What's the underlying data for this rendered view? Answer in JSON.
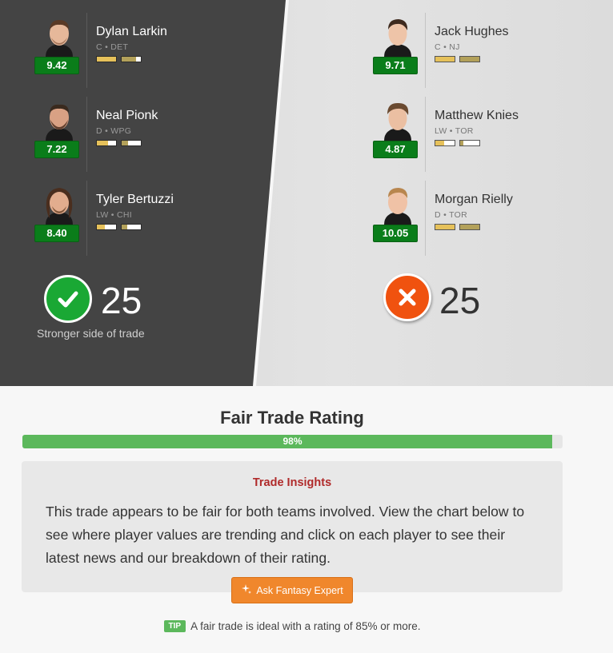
{
  "left_side": {
    "players": [
      {
        "name": "Dylan Larkin",
        "position": "C • DET",
        "rating": "9.42",
        "bar1": 1.0,
        "bar2": 0.75
      },
      {
        "name": "Neal Pionk",
        "position": "D • WPG",
        "rating": "7.22",
        "bar1": 0.6,
        "bar2": 0.35
      },
      {
        "name": "Tyler Bertuzzi",
        "position": "LW • CHI",
        "rating": "8.40",
        "bar1": 0.4,
        "bar2": 0.3
      }
    ],
    "verdict_count": "25",
    "verdict_caption": "Stronger side of trade",
    "verdict_icon": "checkmark-icon",
    "verdict_color": "#1aa834"
  },
  "right_side": {
    "players": [
      {
        "name": "Jack Hughes",
        "position": "C • NJ",
        "rating": "9.71",
        "bar1": 1.0,
        "bar2": 1.0
      },
      {
        "name": "Matthew Knies",
        "position": "LW • TOR",
        "rating": "4.87",
        "bar1": 0.45,
        "bar2": 0.15
      },
      {
        "name": "Morgan Rielly",
        "position": "D • TOR",
        "rating": "10.05",
        "bar1": 1.0,
        "bar2": 1.0
      }
    ],
    "verdict_count": "25",
    "verdict_icon": "x-icon",
    "verdict_color": "#f0520f"
  },
  "bar_colors": {
    "bar1": "#e6c15a",
    "bar2": "#b3a15a"
  },
  "rating": {
    "title": "Fair Trade Rating",
    "percent": 98,
    "percent_label": "98%"
  },
  "insights": {
    "title": "Trade Insights",
    "body": "This trade appears to be fair for both teams involved. View the chart below to see where player values are trending and click on each player to see their latest news and our breakdown of their rating."
  },
  "ask_button": {
    "label": "Ask Fantasy Expert",
    "icon": "sparkle-icon"
  },
  "tip": {
    "badge": "TIP",
    "text": "A fair trade is ideal with a rating of 85% or more."
  }
}
